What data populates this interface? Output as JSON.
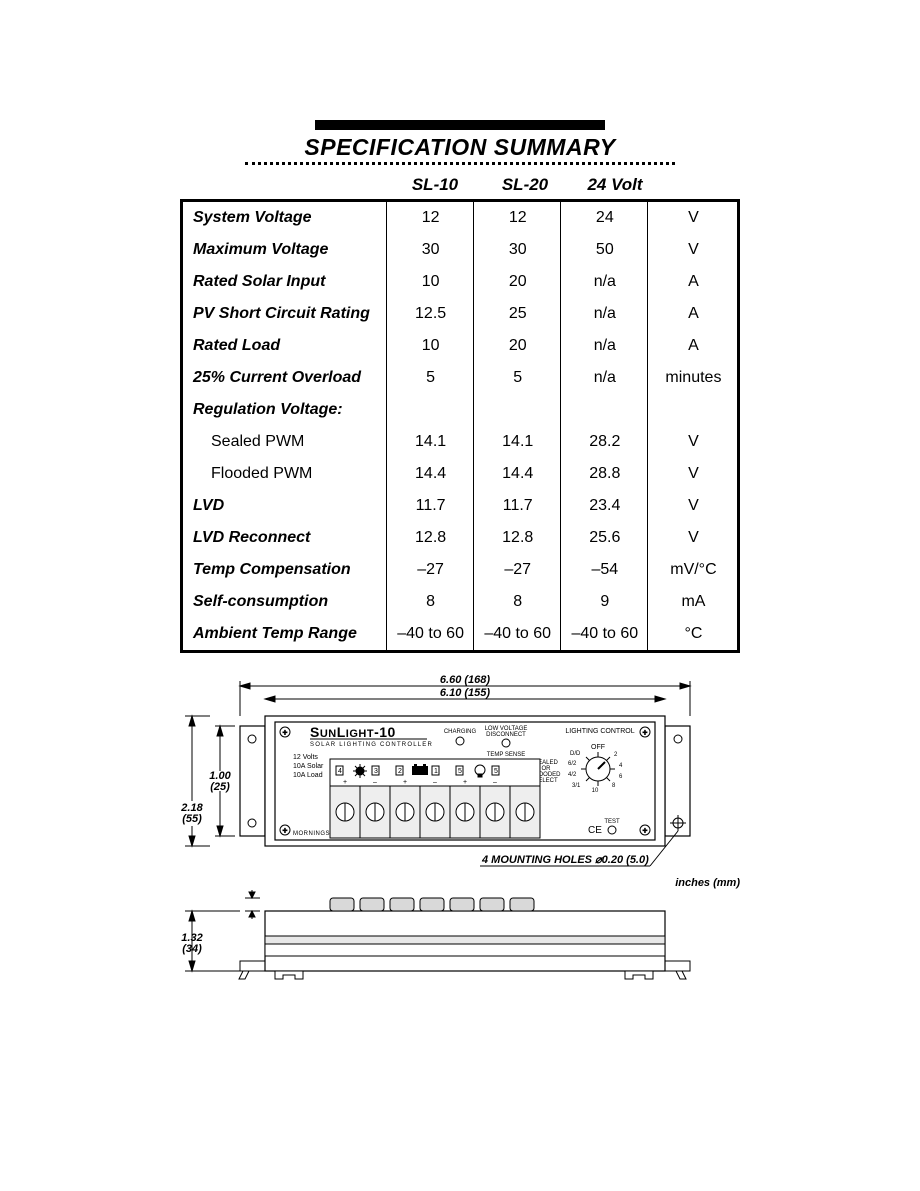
{
  "title": "SPECIFICATION SUMMARY",
  "columns": {
    "c1": "SL-10",
    "c2": "SL-20",
    "c3": "24 Volt"
  },
  "rows": [
    {
      "label": "System Voltage",
      "c1": "12",
      "c2": "12",
      "c3": "24",
      "unit": "V"
    },
    {
      "label": "Maximum Voltage",
      "c1": "30",
      "c2": "30",
      "c3": "50",
      "unit": "V"
    },
    {
      "label": "Rated Solar Input",
      "c1": "10",
      "c2": "20",
      "c3": "n/a",
      "unit": "A"
    },
    {
      "label": "PV Short Circuit Rating",
      "c1": "12.5",
      "c2": "25",
      "c3": "n/a",
      "unit": "A"
    },
    {
      "label": "Rated Load",
      "c1": "10",
      "c2": "20",
      "c3": "n/a",
      "unit": "A"
    },
    {
      "label": "25% Current Overload",
      "c1": "5",
      "c2": "5",
      "c3": "n/a",
      "unit": "minutes"
    },
    {
      "label": "Regulation Voltage:",
      "c1": "",
      "c2": "",
      "c3": "",
      "unit": "",
      "header_only": true
    },
    {
      "label": "Sealed PWM",
      "c1": "14.1",
      "c2": "14.1",
      "c3": "28.2",
      "unit": "V",
      "sub": true
    },
    {
      "label": "Flooded PWM",
      "c1": "14.4",
      "c2": "14.4",
      "c3": "28.8",
      "unit": "V",
      "sub": true
    },
    {
      "label": "LVD",
      "c1": "11.7",
      "c2": "11.7",
      "c3": "23.4",
      "unit": "V"
    },
    {
      "label": "LVD Reconnect",
      "c1": "12.8",
      "c2": "12.8",
      "c3": "25.6",
      "unit": "V"
    },
    {
      "label": "Temp Compensation",
      "c1": "–27",
      "c2": "–27",
      "c3": "–54",
      "unit": "mV/°C"
    },
    {
      "label": "Self-consumption",
      "c1": "8",
      "c2": "8",
      "c3": "9",
      "unit": "mA"
    },
    {
      "label": "Ambient Temp Range",
      "c1": "–40 to 60",
      "c2": "–40 to 60",
      "c3": "–40 to 60",
      "unit": "°C"
    }
  ],
  "drawing": {
    "overall_width": "6.60  (168)",
    "body_width": "6.10  (155)",
    "mount_h": "1.00\n(25)",
    "body_h": "2.18\n(55)",
    "depth": "1.32\n(34)",
    "holes_note": "4 MOUNTING HOLES ⌀0.20 (5.0)",
    "unit_note": "inches (mm)",
    "product_name": "SUNLIGHT-10",
    "product_sub": "SOLAR  LIGHTING  CONTROLLER",
    "brand": "MORNINGSTAR",
    "labels": {
      "charging": "CHARGING",
      "lvd": "LOW VOLTAGE\nDISCONNECT",
      "light": "LIGHTING CONTROL",
      "sealed": "SEALED\nOR\nFLOODED\nSELECT",
      "temp": "TEMP SENSE",
      "test": "TEST",
      "ce": "CE",
      "v12": "12 Volts",
      "a10s": "10A Solar",
      "a10l": "10A Load",
      "dial_off": "OFF",
      "dial_dd": "D/D",
      "dial_62": "6/2",
      "dial_42": "4/2",
      "dial_31": "3/1",
      "dial_10": "10",
      "dial_8": "8",
      "dial_6": "6",
      "dial_4": "4",
      "dial_2": "2",
      "t4": "4",
      "t3": "3",
      "t2": "2",
      "t1": "1",
      "t5": "5"
    }
  }
}
